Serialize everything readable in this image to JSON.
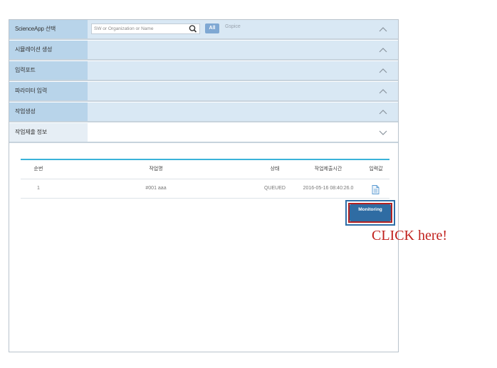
{
  "accordion": [
    {
      "label": "ScienceApp 선택",
      "expanded": false
    },
    {
      "label": "시뮬레이션 생성",
      "expanded": false
    },
    {
      "label": "입력포트",
      "expanded": false
    },
    {
      "label": "파라미터 입력",
      "expanded": false
    },
    {
      "label": "작업생성",
      "expanded": false
    },
    {
      "label": "작업제출 정보",
      "expanded": true
    }
  ],
  "search": {
    "placeholder": "SW or Organization or Name",
    "all_label": "All",
    "filter_label": "Gspice"
  },
  "jobs_table": {
    "headers": [
      "순번",
      "작업명",
      "상태",
      "작업제출시간",
      "입력값"
    ],
    "rows": [
      {
        "no": "1",
        "name": "#001 aaa",
        "status": "QUEUED",
        "submitted": "2016-05-16 08:40:26.0",
        "input_icon": "document-icon"
      }
    ]
  },
  "monitoring_button": "Monitoring",
  "annotation": "CLICK here!",
  "colors": {
    "label_bg": "#b8d4ea",
    "row_bg": "#d9e8f4",
    "table_top_line": "#3ab3d9",
    "button": "#2f6ca3",
    "annotation": "#c0201c"
  }
}
